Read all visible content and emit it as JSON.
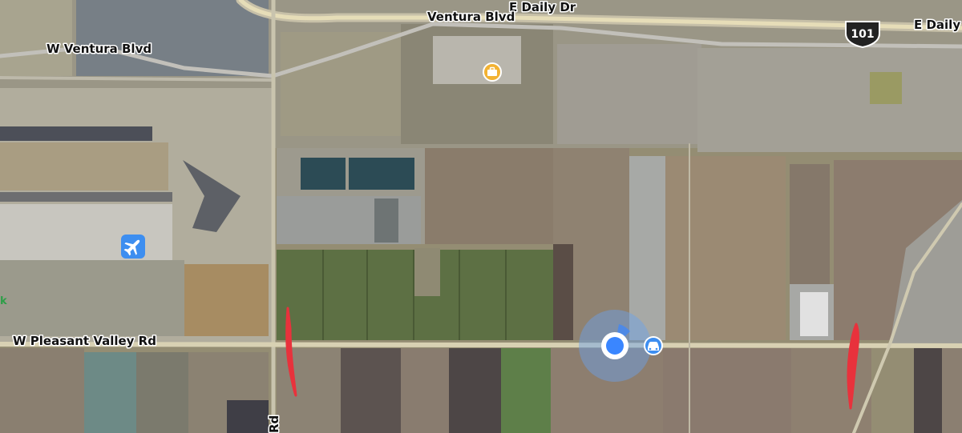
{
  "map": {
    "labels": {
      "e_daily_dr_top": "E Daily Dr",
      "ventura_blvd": "Ventura Blvd",
      "w_ventura_blvd": "W Ventura Blvd",
      "w_pleasant_valley_rd": "W Pleasant Valley Rd",
      "e_daily_right": "E Daily",
      "rd_vertical": "Rd",
      "edge_letter": "k"
    },
    "highway_shield": "101",
    "poi_icons": [
      "airport-icon",
      "briefcase-icon",
      "car-icon"
    ],
    "colors": {
      "user_location": "#3a86ff",
      "location_halo": "#6aa2ee",
      "route_marks": "#e8323c",
      "airport_badge": "#3d8ef0",
      "poi_badge": "#f2b233",
      "car_badge": "#3d8ef0"
    }
  }
}
